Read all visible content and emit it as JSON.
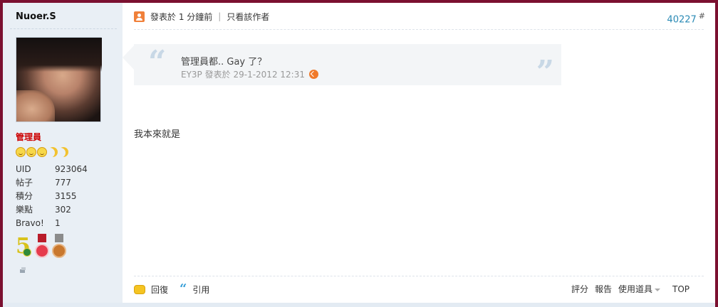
{
  "user": {
    "name": "Nuoer.S",
    "role": "管理員",
    "stats": [
      {
        "label": "UID",
        "value": "923064"
      },
      {
        "label": "帖子",
        "value": "777"
      },
      {
        "label": "積分",
        "value": "3155"
      },
      {
        "label": "樂點",
        "value": "302"
      },
      {
        "label": "Bravo!",
        "value": "1"
      }
    ],
    "rank_icons": [
      "sun-icon",
      "sun-icon",
      "sun-icon",
      "moon-icon",
      "moon-icon"
    ],
    "medals": [
      "medal-5-icon",
      "medal-red-icon",
      "medal-bronze-icon"
    ]
  },
  "post": {
    "posted_label": "發表於",
    "posted_time": "1 分鐘前",
    "separator": "|",
    "only_author": "只看該作者",
    "number": "40227",
    "number_suffix": "#",
    "quote": {
      "open_mark": "“",
      "close_mark": "”",
      "text": "管理員都.. Gay 了？",
      "author": "EY3P",
      "posted_label": "發表於",
      "date": "29-1-2012 12:31"
    },
    "body": "我本來就是"
  },
  "footer": {
    "reply": "回復",
    "quote": "引用",
    "rate": "評分",
    "report": "報告",
    "use_tools": "使用道具",
    "top": "TOP"
  },
  "colors": {
    "frame": "#7b1030",
    "sidebar_bg": "#e9eff5",
    "role": "#cc0000",
    "post_number": "#2a8ab5",
    "quote_bg": "#f3f5f7"
  }
}
